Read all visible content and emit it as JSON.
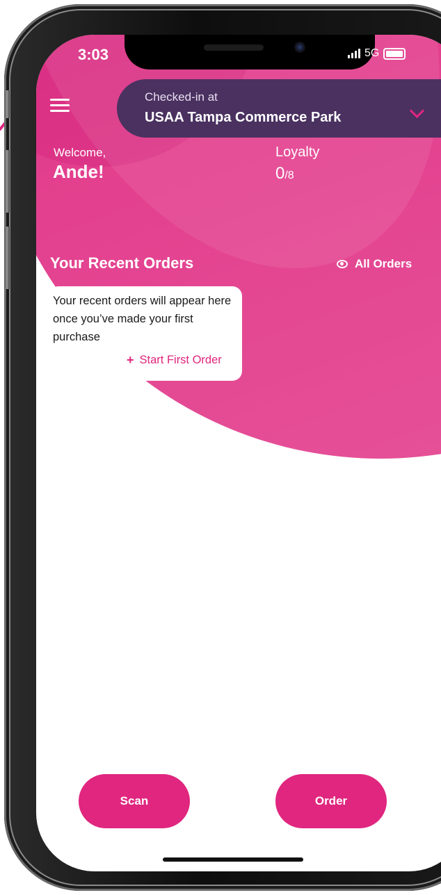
{
  "status_bar": {
    "time": "3:03",
    "network": "5G"
  },
  "header": {
    "checkin_label": "Checked-in at",
    "location": "USAA Tampa Commerce Park"
  },
  "welcome": {
    "label": "Welcome,",
    "name": "Ande!"
  },
  "loyalty": {
    "label": "Loyalty",
    "count": "0",
    "total": "/8"
  },
  "recent_orders": {
    "title": "Your Recent Orders",
    "all_orders_label": "All Orders",
    "empty_message": "Your recent orders will appear here once you’ve made your first purchase",
    "start_order_label": "Start First Order"
  },
  "actions": {
    "scan_label": "Scan",
    "order_label": "Order"
  },
  "icons": {
    "menu": "hamburger-menu-icon",
    "dropdown": "chevron-down-icon",
    "view": "eye-icon",
    "add": "plus-icon"
  },
  "colors": {
    "brand_pink": "#e0267f",
    "checkin_bg": "#4a3160",
    "card_bg": "#ffffff"
  }
}
